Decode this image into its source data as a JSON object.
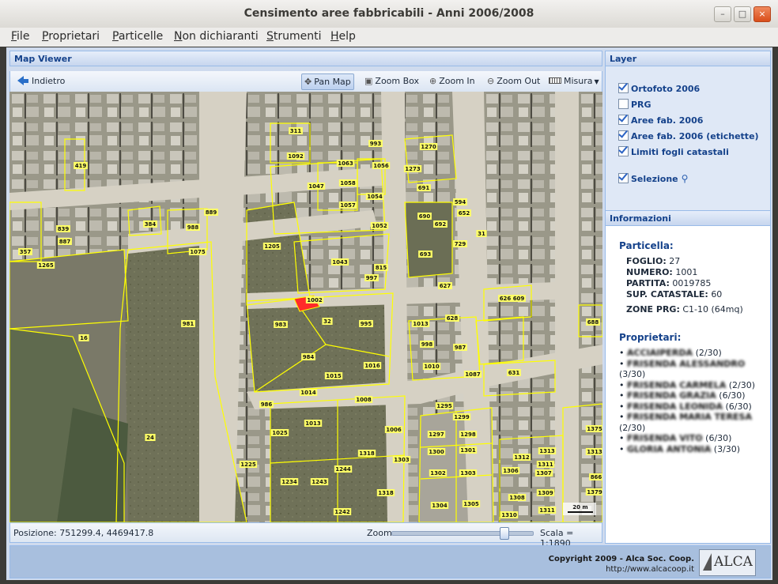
{
  "window": {
    "title": "Censimento aree fabbricabili - Anni 2006/2008"
  },
  "menu": [
    "File",
    "Proprietari",
    "Particelle",
    "Non dichiaranti",
    "Strumenti",
    "Help"
  ],
  "map_viewer": {
    "title": "Map Viewer",
    "back_label": "Indietro",
    "tools": {
      "pan": "Pan Map",
      "zoom_box": "Zoom Box",
      "zoom_in": "Zoom In",
      "zoom_out": "Zoom Out",
      "measure": "Misura"
    },
    "status": {
      "position": "Posizione: 751299.4, 4469417.8",
      "zoom_label": "Zoom",
      "zoom_level": 0.82,
      "scale": "Scala = 1:1890"
    },
    "scalebar": "20 m",
    "parcel_labels": [
      "311",
      "1092",
      "993",
      "1063",
      "1056",
      "1270",
      "1273",
      "419",
      "1047",
      "1058",
      "1054",
      "1057",
      "1052",
      "691",
      "594",
      "652",
      "690",
      "692",
      "988",
      "384",
      "889",
      "1075",
      "1205",
      "1043",
      "729",
      "693",
      "31",
      "357",
      "1265",
      "839",
      "887",
      "997",
      "815",
      "627",
      "626",
      "609",
      "1002",
      "983",
      "32",
      "995",
      "981",
      "16",
      "628",
      "1013",
      "998",
      "987",
      "984",
      "1015",
      "1016",
      "1010",
      "688",
      "1087",
      "631",
      "1014",
      "1008",
      "986",
      "1295",
      "1299",
      "1013",
      "1006",
      "1297",
      "1298",
      "24",
      "1025",
      "1313",
      "1311",
      "1300",
      "1301",
      "1375",
      "1312",
      "1313",
      "1225",
      "1243",
      "1244",
      "1318",
      "1303",
      "1302",
      "1303",
      "1306",
      "1307",
      "866",
      "1379",
      "1234",
      "1242",
      "1318",
      "1304",
      "1305",
      "1308",
      "1309",
      "1310",
      "1311"
    ]
  },
  "layers": {
    "title": "Layer",
    "items": [
      {
        "label": "Ortofoto 2006",
        "checked": true
      },
      {
        "label": "PRG",
        "checked": false
      },
      {
        "label": "Aree fab. 2006",
        "checked": true
      },
      {
        "label": "Aree fab. 2006 (etichette)",
        "checked": true
      },
      {
        "label": "Limiti fogli catastali",
        "checked": true
      },
      {
        "label": "Selezione",
        "checked": true
      }
    ]
  },
  "info": {
    "title": "Informazioni",
    "particella_heading": "Particella:",
    "foglio_label": "FOGLIO:",
    "foglio": "27",
    "numero_label": "NUMERO:",
    "numero": "1001",
    "partita_label": "PARTITA:",
    "partita": "0019785",
    "sup_label": "SUP. CATASTALE:",
    "sup": "60",
    "zone_label": "ZONE PRG:",
    "zone": "C1-10 (64mq)",
    "proprietari_heading": "Proprietari:",
    "owners": [
      {
        "name": "ACCIAIPERDA",
        "share": "(2/30)"
      },
      {
        "name": "FRISENDA ALESSANDRO",
        "share": "(3/30)"
      },
      {
        "name": "FRISENDA CARMELA",
        "share": "(2/30)"
      },
      {
        "name": "FRISENDA GRAZIA",
        "share": "(6/30)"
      },
      {
        "name": "FRISENDA LEONIDA",
        "share": "(6/30)"
      },
      {
        "name": "FRISENDA MARIA TERESA",
        "share": "(2/30)"
      },
      {
        "name": "FRISENDA VITO",
        "share": "(6/30)"
      },
      {
        "name": "GLORIA ANTONIA",
        "share": "(3/30)"
      }
    ]
  },
  "footer": {
    "copyright": "Copyright 2009 - Alca Soc. Coop.",
    "url": "http://www.alcacoop.it",
    "logo_text": "ALCA"
  }
}
